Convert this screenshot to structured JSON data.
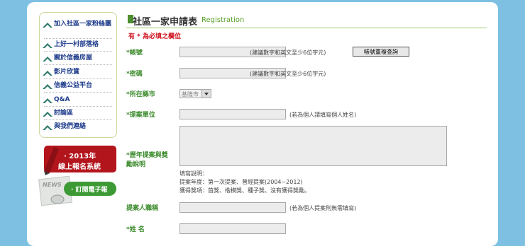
{
  "sidebar": {
    "items": [
      {
        "label": "加入社區一家粉絲團"
      },
      {
        "label": "上好一村部落格"
      },
      {
        "label": "關於信義房屋"
      },
      {
        "label": "影片欣賞"
      },
      {
        "label": "信義公益平台"
      },
      {
        "label": "Q&A"
      },
      {
        "label": "討論區"
      },
      {
        "label": "與我們連絡"
      }
    ],
    "banner_2013_line1": "· 2013年",
    "banner_2013_line2": "線上報名系統",
    "news_label": "NEWS",
    "subscribe_label": "· 訂閱電子報"
  },
  "header": {
    "title": "社區一家申請表",
    "title_en": "Registration",
    "required_note": "有 * 為必填之欄位"
  },
  "form": {
    "account_label": "*帳號",
    "account_hint": "(建議數字和英文至少6位字元)",
    "check_button": "帳號重複查詢",
    "password_label": "*密碼",
    "password_hint": "(建議數字和英文至少6位字元)",
    "city_label": "*所在縣市",
    "city_value": "基隆市",
    "unit_label": "*提案單位",
    "unit_hint": "(若為個人請填寫個人姓名)",
    "history_label_1": "*歷年提案與獎",
    "history_label_2": "勵說明",
    "notes": [
      "填寫說明：",
      "提案年度：第一次提案、曾經提案(2004~2012)",
      "獲得獎項：首獎、楷模獎、種子獎、沒有獲得獎勵。"
    ],
    "title_label": "提案人職稱",
    "title_hint": "(若為個人提案則無需填寫)",
    "name_label": "*姓 名"
  },
  "colors": {
    "background": "#7ec0e2",
    "accent_green": "#3a8a2a",
    "required_red": "#d0121d",
    "menu_text": "#1e3c8c",
    "banner_red": "#b3151c"
  }
}
